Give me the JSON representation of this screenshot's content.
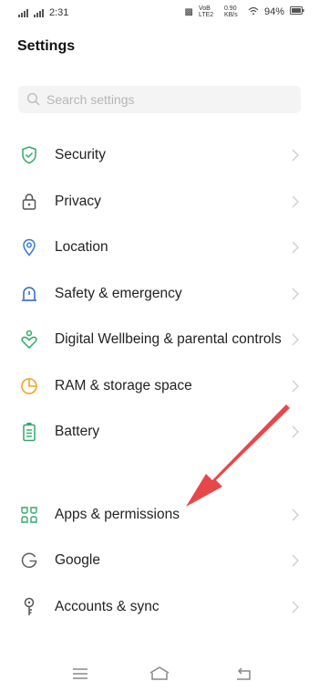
{
  "status": {
    "time": "2:31",
    "network_label": "VoB LTE2",
    "speed": "0.90 KB/s",
    "battery": "94%"
  },
  "page": {
    "title": "Settings"
  },
  "search": {
    "placeholder": "Search settings"
  },
  "items": [
    {
      "label": "Security",
      "icon": "shield-icon",
      "color": "#2faa6b"
    },
    {
      "label": "Privacy",
      "icon": "lock-icon",
      "color": "#555555"
    },
    {
      "label": "Location",
      "icon": "location-pin-icon",
      "color": "#3a7bd5"
    },
    {
      "label": "Safety & emergency",
      "icon": "alert-beacon-icon",
      "color": "#2f67c7"
    },
    {
      "label": "Digital Wellbeing & parental controls",
      "icon": "wellbeing-icon",
      "color": "#2faa6b"
    },
    {
      "label": "RAM & storage space",
      "icon": "pie-chart-icon",
      "color": "#f0a324"
    },
    {
      "label": "Battery",
      "icon": "battery-icon",
      "color": "#2faa6b"
    },
    {
      "label": "Apps & permissions",
      "icon": "apps-icon",
      "color": "#2faa6b"
    },
    {
      "label": "Google",
      "icon": "google-icon",
      "color": "#666666"
    },
    {
      "label": "Accounts & sync",
      "icon": "key-icon",
      "color": "#555555"
    }
  ],
  "annotation": {
    "color": "#e8474a"
  }
}
